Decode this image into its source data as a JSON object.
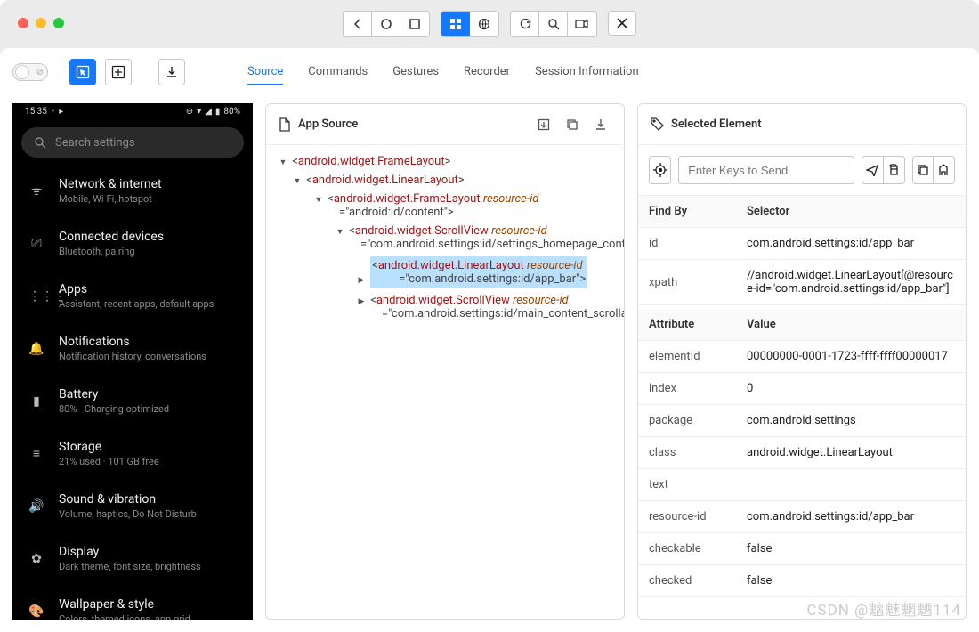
{
  "top_toolbar": {
    "group_nav": [
      "back",
      "circle",
      "square"
    ],
    "group_view": [
      "grid",
      "globe"
    ],
    "group_util": [
      "refresh",
      "search",
      "record"
    ],
    "close": "close"
  },
  "subbar": {
    "tabs": {
      "source": "Source",
      "commands": "Commands",
      "gestures": "Gestures",
      "recorder": "Recorder",
      "session_info": "Session Information"
    }
  },
  "device": {
    "status_time": "15:35",
    "status_battery": "80%",
    "search_placeholder": "Search settings",
    "items": [
      {
        "title": "Network & internet",
        "sub": "Mobile, Wi-Fi, hotspot",
        "icon": "wifi"
      },
      {
        "title": "Connected devices",
        "sub": "Bluetooth, pairing",
        "icon": "devices"
      },
      {
        "title": "Apps",
        "sub": "Assistant, recent apps, default apps",
        "icon": "apps"
      },
      {
        "title": "Notifications",
        "sub": "Notification history, conversations",
        "icon": "bell"
      },
      {
        "title": "Battery",
        "sub": "80% - Charging optimized",
        "icon": "battery"
      },
      {
        "title": "Storage",
        "sub": "21% used · 101 GB free",
        "icon": "storage"
      },
      {
        "title": "Sound & vibration",
        "sub": "Volume, haptics, Do Not Disturb",
        "icon": "sound"
      },
      {
        "title": "Display",
        "sub": "Dark theme, font size, brightness",
        "icon": "display"
      },
      {
        "title": "Wallpaper & style",
        "sub": "Colors, themed icons, app grid",
        "icon": "palette"
      }
    ]
  },
  "app_source": {
    "title": "App Source",
    "tree": {
      "n0": {
        "tag": "android.widget.FrameLayout"
      },
      "n1": {
        "tag": "android.widget.LinearLayout"
      },
      "n2": {
        "tag": "android.widget.FrameLayout",
        "attr": "resource-id",
        "val": "\"android:id/content\""
      },
      "n3": {
        "tag": "android.widget.ScrollView",
        "attr": "resource-id",
        "val": "\"com.android.settings:id/settings_homepage_container\""
      },
      "n4": {
        "tag": "android.widget.LinearLayout",
        "attr": "resource-id",
        "val": "\"com.android.settings:id/app_bar\""
      },
      "n5": {
        "tag": "android.widget.ScrollView",
        "attr": "resource-id",
        "val": "\"com.android.settings:id/main_content_scrollable_container\""
      }
    }
  },
  "selected_element": {
    "title": "Selected Element",
    "input_placeholder": "Enter Keys to Send",
    "findby_header": {
      "k": "Find By",
      "v": "Selector"
    },
    "findby": [
      {
        "k": "id",
        "v": "com.android.settings:id/app_bar"
      },
      {
        "k": "xpath",
        "v": "//android.widget.LinearLayout[@resource-id=\"com.android.settings:id/app_bar\"]"
      }
    ],
    "attr_header": {
      "k": "Attribute",
      "v": "Value"
    },
    "attrs": [
      {
        "k": "elementId",
        "v": "00000000-0001-1723-ffff-ffff00000017"
      },
      {
        "k": "index",
        "v": "0"
      },
      {
        "k": "package",
        "v": "com.android.settings"
      },
      {
        "k": "class",
        "v": "android.widget.LinearLayout"
      },
      {
        "k": "text",
        "v": ""
      },
      {
        "k": "resource-id",
        "v": "com.android.settings:id/app_bar"
      },
      {
        "k": "checkable",
        "v": "false"
      },
      {
        "k": "checked",
        "v": "false"
      }
    ]
  },
  "watermark": "CSDN @魑魅魍魉114"
}
